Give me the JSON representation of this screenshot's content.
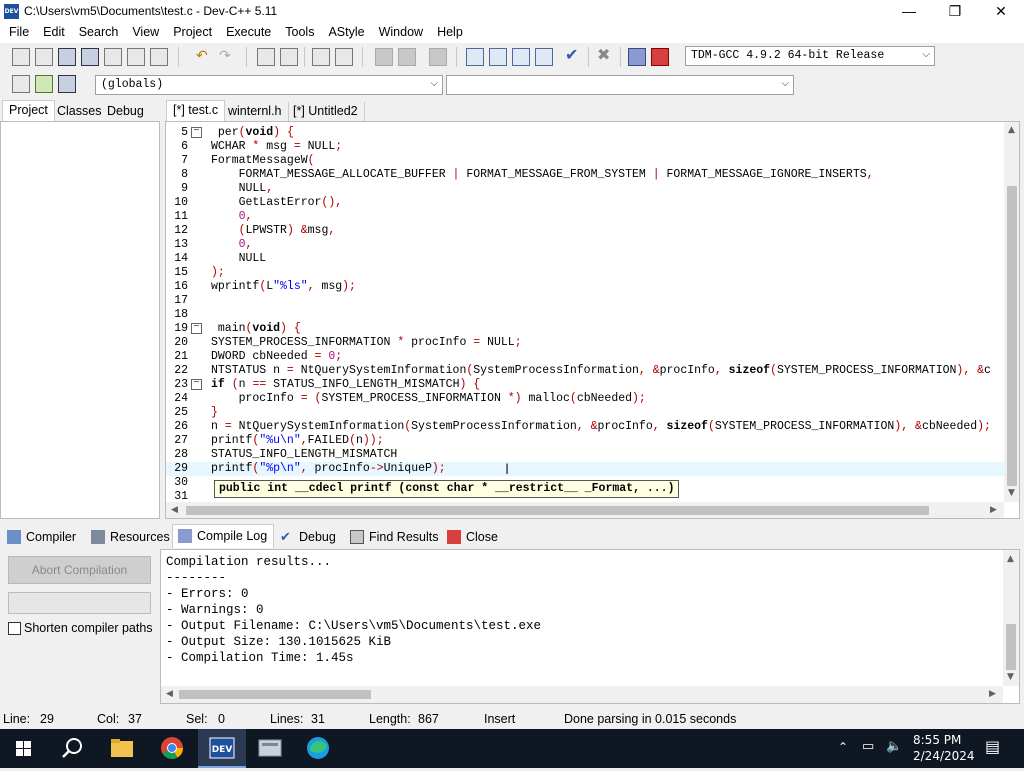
{
  "window": {
    "title": "C:\\Users\\vm5\\Documents\\test.c - Dev-C++ 5.11",
    "icon_label": "DEV",
    "controls": {
      "minimize": "—",
      "maximize": "❐",
      "close": "✕"
    }
  },
  "menu": [
    "File",
    "Edit",
    "Search",
    "View",
    "Project",
    "Execute",
    "Tools",
    "AStyle",
    "Window",
    "Help"
  ],
  "toolbar": {
    "compiler_select": "TDM-GCC 4.9.2 64-bit Release",
    "scope_select": "(globals)",
    "function_select": ""
  },
  "left_tabs": [
    "Project",
    "Classes",
    "Debug"
  ],
  "editor_tabs": [
    "[*] test.c",
    "winternl.h",
    "[*] Untitled2"
  ],
  "code_lines": [
    {
      "num": "5",
      "fold": "−",
      "text": " per(void) {"
    },
    {
      "num": "6",
      "fold": "",
      "text": "WCHAR * msg = NULL;"
    },
    {
      "num": "7",
      "fold": "",
      "text": "FormatMessageW("
    },
    {
      "num": "8",
      "fold": "",
      "text": "    FORMAT_MESSAGE_ALLOCATE_BUFFER | FORMAT_MESSAGE_FROM_SYSTEM | FORMAT_MESSAGE_IGNORE_INSERTS,"
    },
    {
      "num": "9",
      "fold": "",
      "text": "    NULL,"
    },
    {
      "num": "10",
      "fold": "",
      "text": "    GetLastError(),"
    },
    {
      "num": "11",
      "fold": "",
      "text": "    0,"
    },
    {
      "num": "12",
      "fold": "",
      "text": "    (LPWSTR) &msg,"
    },
    {
      "num": "13",
      "fold": "",
      "text": "    0,"
    },
    {
      "num": "14",
      "fold": "",
      "text": "    NULL"
    },
    {
      "num": "15",
      "fold": "",
      "text": ");"
    },
    {
      "num": "16",
      "fold": "",
      "text": "wprintf(L\"%ls\", msg);"
    },
    {
      "num": "17",
      "fold": "",
      "text": ""
    },
    {
      "num": "18",
      "fold": "",
      "text": ""
    },
    {
      "num": "19",
      "fold": "−",
      "text": " main(void) {"
    },
    {
      "num": "20",
      "fold": "",
      "text": "SYSTEM_PROCESS_INFORMATION * procInfo = NULL;"
    },
    {
      "num": "21",
      "fold": "",
      "text": "DWORD cbNeeded = 0;"
    },
    {
      "num": "22",
      "fold": "",
      "text": "NTSTATUS n = NtQuerySystemInformation(SystemProcessInformation, &procInfo, sizeof(SYSTEM_PROCESS_INFORMATION), &c"
    },
    {
      "num": "23",
      "fold": "−",
      "text": "if (n == STATUS_INFO_LENGTH_MISMATCH) {"
    },
    {
      "num": "24",
      "fold": "",
      "text": "    procInfo = (SYSTEM_PROCESS_INFORMATION *) malloc(cbNeeded);"
    },
    {
      "num": "25",
      "fold": "",
      "text": "}"
    },
    {
      "num": "26",
      "fold": "",
      "text": "n = NtQuerySystemInformation(SystemProcessInformation, &procInfo, sizeof(SYSTEM_PROCESS_INFORMATION), &cbNeeded);"
    },
    {
      "num": "27",
      "fold": "",
      "text": "printf(\"%u\\n\",FAILED(n));"
    },
    {
      "num": "28",
      "fold": "",
      "text": "STATUS_INFO_LENGTH_MISMATCH"
    },
    {
      "num": "29",
      "fold": "",
      "text": "printf(\"%p\\n\", procInfo->UniqueP);"
    },
    {
      "num": "30",
      "fold": "",
      "text": ""
    },
    {
      "num": "31",
      "fold": "",
      "text": ""
    }
  ],
  "tooltip": "public int __cdecl printf (const char * __restrict__ _Format, ...)",
  "bottom_tabs": [
    "Compiler",
    "Resources",
    "Compile Log",
    "Debug",
    "Find Results",
    "Close"
  ],
  "compile_panel": {
    "abort_label": "Abort Compilation",
    "shorten_label": "Shorten compiler paths",
    "shorten_checked": false,
    "log": [
      "Compilation results...",
      "--------",
      "- Errors: 0",
      "- Warnings: 0",
      "- Output Filename: C:\\Users\\vm5\\Documents\\test.exe",
      "- Output Size: 130.1015625 KiB",
      "- Compilation Time: 1.45s"
    ]
  },
  "status": {
    "line_label": "Line:",
    "line": "29",
    "col_label": "Col:",
    "col": "37",
    "sel_label": "Sel:",
    "sel": "0",
    "lines_label": "Lines:",
    "lines": "31",
    "length_label": "Length:",
    "length": "867",
    "mode": "Insert",
    "message": "Done parsing in 0.015 seconds"
  },
  "taskbar": {
    "time": "8:55 PM",
    "date": "2/24/2024",
    "apps": [
      "start-icon",
      "search-icon",
      "file-explorer-icon",
      "chrome-icon",
      "devcpp-icon",
      "app-icon",
      "edge-icon"
    ]
  },
  "colors": {
    "keyword": "#000000",
    "string": "#0000ff",
    "number": "#b10a7a",
    "symbol": "#c00000",
    "current_line": "#e6f7ff",
    "taskbar": "#0f1722"
  }
}
